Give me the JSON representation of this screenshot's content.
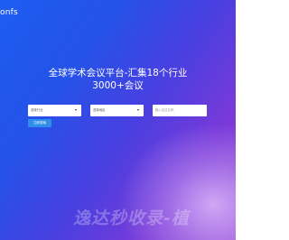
{
  "header": {
    "logo_text": "onfs"
  },
  "hero": {
    "title_line1": "全球学术会议平台-汇集18个行业",
    "title_line2": "3000+会议"
  },
  "search": {
    "field1_value": "选择行业",
    "field2_value": "选择地区",
    "field3_placeholder": "输入会议名称",
    "button_label": "立即搜索"
  },
  "watermark": {
    "text": "逸达秒收录-植"
  },
  "colors": {
    "background_start": "#1d5df0",
    "background_end": "#9b4fd6",
    "button": "#2f8fe8"
  },
  "icons": {
    "dropdown": "chevron-down-icon"
  }
}
